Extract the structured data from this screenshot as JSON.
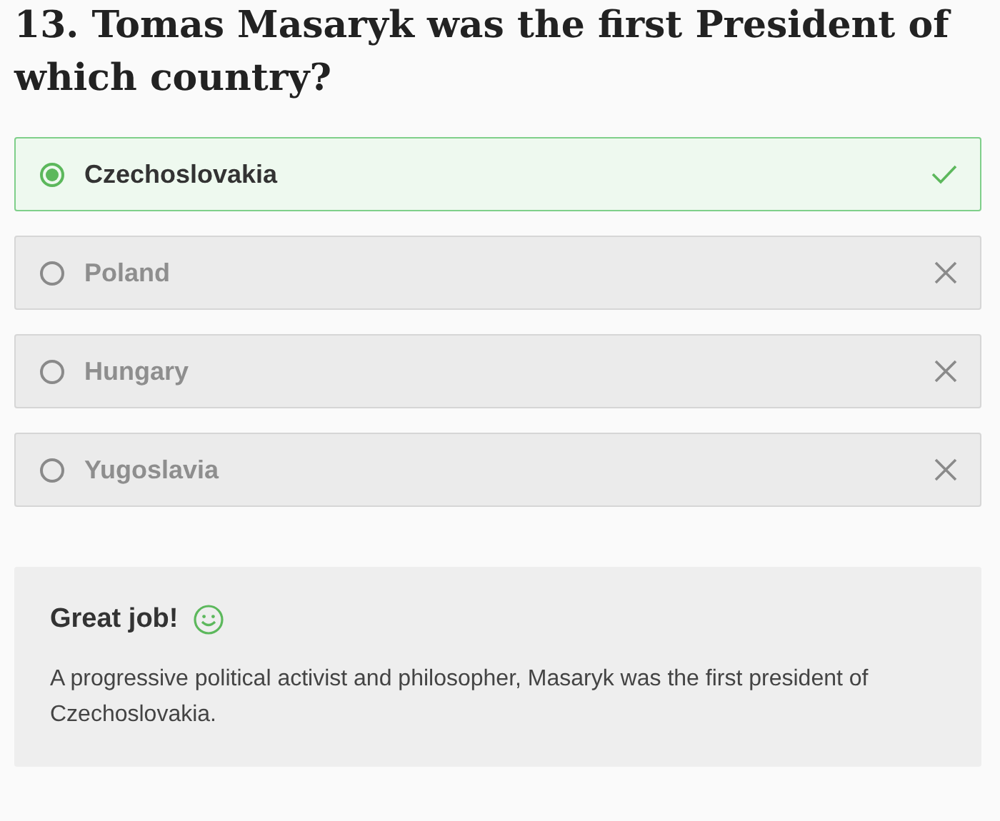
{
  "question": "13. Tomas Masaryk was the first President of which country?",
  "options": [
    {
      "label": "Czechoslovakia",
      "selected": true,
      "correct": true
    },
    {
      "label": "Poland",
      "selected": false,
      "correct": false
    },
    {
      "label": "Hungary",
      "selected": false,
      "correct": false
    },
    {
      "label": "Yugoslavia",
      "selected": false,
      "correct": false
    }
  ],
  "feedback": {
    "title": "Great job!",
    "text": "A progressive political activist and philosopher, Masaryk was the first president of Czechoslovakia."
  }
}
